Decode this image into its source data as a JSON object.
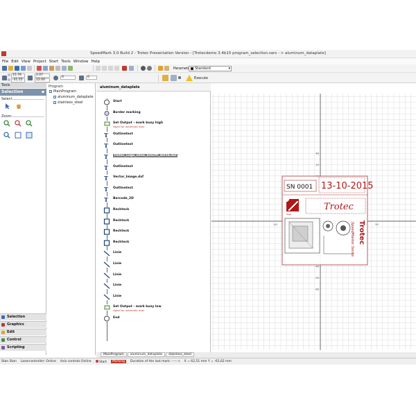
{
  "window": {
    "title": "SpeedMark 3.0 Build 2 - Trotec Presentation Version - [Trotecdemo 3.4b15 program_selection.sars - > aluminum_dataplate]"
  },
  "menu": [
    "File",
    "Edit",
    "View",
    "Project",
    "Start",
    "Tools",
    "Window",
    "Help"
  ],
  "toolbar": {
    "parameters_label": "Parameters:",
    "parameters_value": "Standard",
    "execute_label": "Execute",
    "coord_x": "15.76",
    "coord_y": "-31.55",
    "size_w": "2.07",
    "size_h": "12.00",
    "rotation": "0",
    "count": "0"
  },
  "tools_panel": {
    "header": "Tools",
    "active": "Selection",
    "groups": [
      "Select",
      "Zoom"
    ],
    "nav": [
      "Selection",
      "Graphics",
      "Edit",
      "Control",
      "Scripting"
    ]
  },
  "program_panel": {
    "header": "Program",
    "tree": [
      "MainProgram",
      "aluminum_dataplate",
      "stainless_steel"
    ]
  },
  "list_panel": {
    "title": "aluminum_dataplate",
    "items": [
      {
        "label": "Start",
        "sub": ""
      },
      {
        "label": "Border marking",
        "sub": ""
      },
      {
        "label": "Set Output - mark busy high",
        "sub": "signal for automatic door"
      },
      {
        "label": "Outlinetext",
        "sub": ""
      },
      {
        "label": "Outlinetext",
        "sub": ""
      },
      {
        "label": "Trotec_Logo_ohne_Schrift_dxf16.dxf",
        "sub": ""
      },
      {
        "label": "Outlinetext",
        "sub": ""
      },
      {
        "label": "Vector_Image.dxf",
        "sub": ""
      },
      {
        "label": "Outlinetext",
        "sub": ""
      },
      {
        "label": "Barcode_2D",
        "sub": ""
      },
      {
        "label": "Rechteck",
        "sub": ""
      },
      {
        "label": "Rechteck",
        "sub": ""
      },
      {
        "label": "Rechteck",
        "sub": ""
      },
      {
        "label": "Rechteck",
        "sub": ""
      },
      {
        "label": "Linie",
        "sub": ""
      },
      {
        "label": "Linie",
        "sub": ""
      },
      {
        "label": "Linie",
        "sub": ""
      },
      {
        "label": "Linie",
        "sub": ""
      },
      {
        "label": "Linie",
        "sub": ""
      },
      {
        "label": "Set Output - mark busy low",
        "sub": "signal for automatic door"
      },
      {
        "label": "End",
        "sub": ""
      }
    ]
  },
  "canvas": {
    "x_ticks": [
      "-40",
      "-30",
      "-20",
      "-10",
      "10",
      "20",
      "30",
      "40",
      "50"
    ],
    "y_ticks": [
      "60",
      "50",
      "40",
      "30",
      "20",
      "10",
      "-10",
      "-20",
      "-30",
      "-40",
      "-50",
      "-60"
    ],
    "plate": {
      "serial": "SN 0001",
      "date": "13-10-2015",
      "brand": "Trotec",
      "vertical_brand": "Trotec",
      "vertical_series": "SpeedMarker Series",
      "small_label": "Spez"
    }
  },
  "bottom_tabs": [
    "MainProgram",
    "aluminum_dataplate",
    "stainless_steel"
  ],
  "status_bar": {
    "state": "Stan Stan",
    "laser": "Lasercontroller: Online",
    "axis": "Axis controls Online",
    "start": "Start",
    "marking": "Marking",
    "duration": "Duration of the last mark: ----- s",
    "coords": "X = 62,51 mm    Y = -61,62 mm"
  },
  "colors": {
    "accent_red": "#c0392b",
    "selection_header": "#7c93aa"
  }
}
